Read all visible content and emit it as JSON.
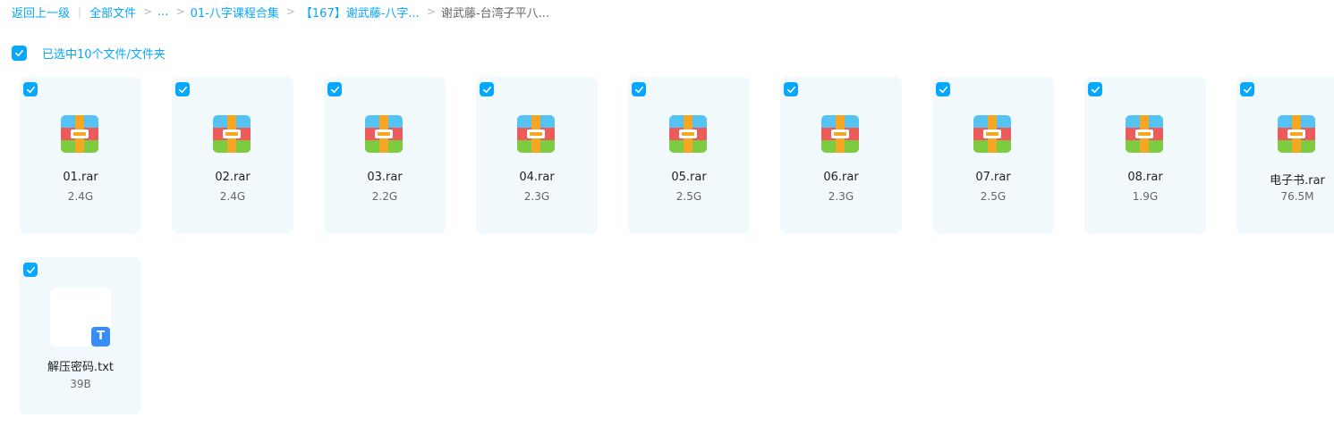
{
  "breadcrumb": {
    "back": "返回上一级",
    "all_files": "全部文件",
    "ellipsis": "...",
    "level1": "01-八字课程合集",
    "level2": "【167】谢武藤-八字...",
    "current": "谢武藤-台湾子平八..."
  },
  "selection": {
    "label": "已选中10个文件/文件夹",
    "checked": true
  },
  "colors": {
    "accent": "#06a7ff",
    "card_bg": "#f1f9fd",
    "rar_top": "#55c3f1",
    "rar_mid": "#ee5b5b",
    "rar_bottom": "#7dcc3f",
    "rar_strap": "#f5a623",
    "txt_badge": "#3a8df5"
  },
  "files": [
    {
      "name": "01.rar",
      "size": "2.4G",
      "type": "rar",
      "icon": "rar-archive-icon",
      "checked": true
    },
    {
      "name": "02.rar",
      "size": "2.4G",
      "type": "rar",
      "icon": "rar-archive-icon",
      "checked": true
    },
    {
      "name": "03.rar",
      "size": "2.2G",
      "type": "rar",
      "icon": "rar-archive-icon",
      "checked": true
    },
    {
      "name": "04.rar",
      "size": "2.3G",
      "type": "rar",
      "icon": "rar-archive-icon",
      "checked": true
    },
    {
      "name": "05.rar",
      "size": "2.5G",
      "type": "rar",
      "icon": "rar-archive-icon",
      "checked": true
    },
    {
      "name": "06.rar",
      "size": "2.3G",
      "type": "rar",
      "icon": "rar-archive-icon",
      "checked": true
    },
    {
      "name": "07.rar",
      "size": "2.5G",
      "type": "rar",
      "icon": "rar-archive-icon",
      "checked": true
    },
    {
      "name": "08.rar",
      "size": "1.9G",
      "type": "rar",
      "icon": "rar-archive-icon",
      "checked": true
    },
    {
      "name": "电子书.rar",
      "size": "76.5M",
      "type": "rar",
      "icon": "rar-archive-icon",
      "checked": true
    },
    {
      "name": "解压密码.txt",
      "size": "39B",
      "type": "txt",
      "icon": "txt-file-icon",
      "badge": "T",
      "checked": true
    }
  ]
}
